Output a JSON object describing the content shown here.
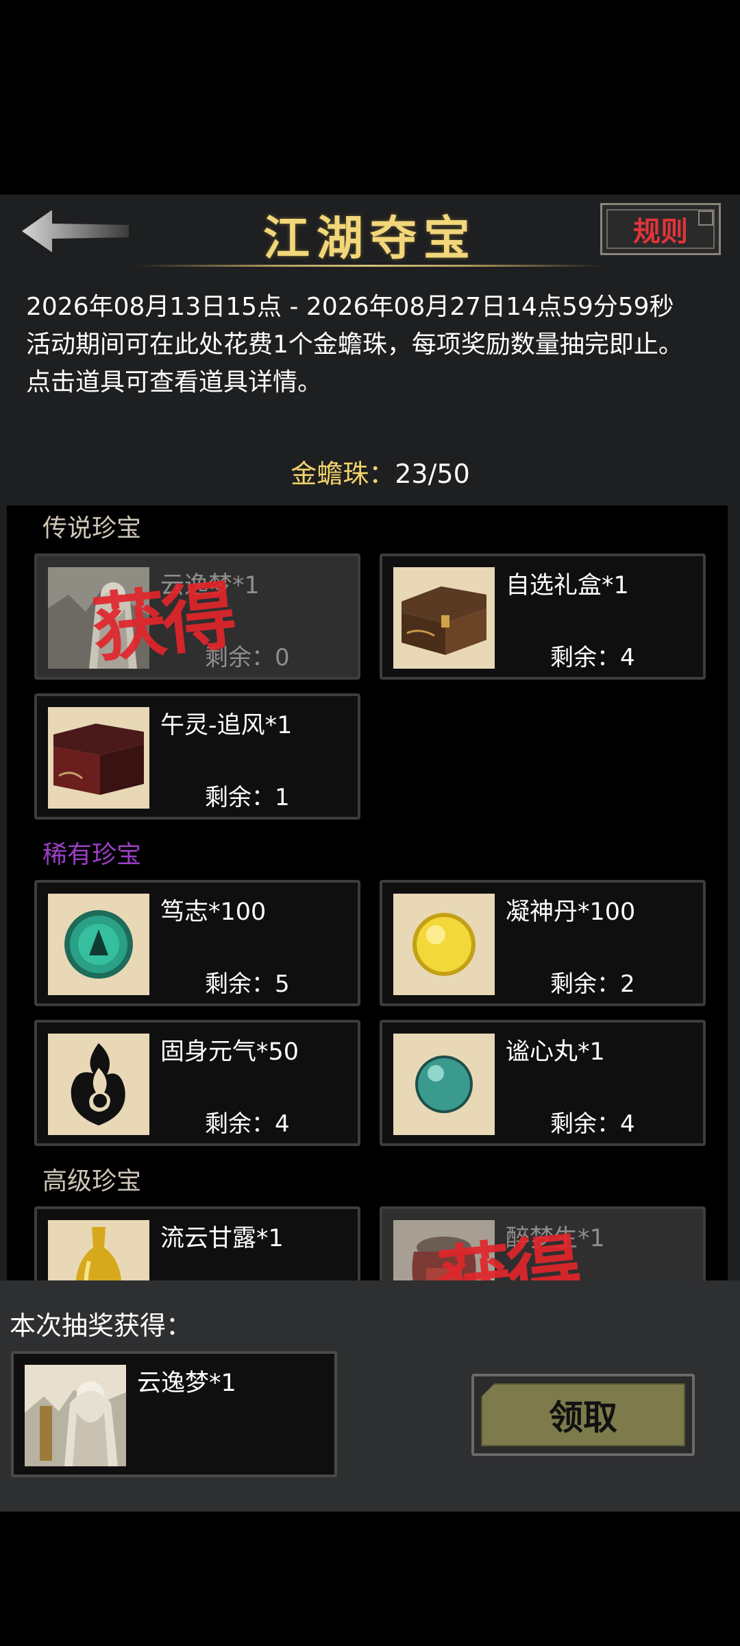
{
  "header": {
    "title": "江湖夺宝",
    "rules_label": "规则"
  },
  "description": {
    "line1": "2026年08月13日15点 - 2026年08月27日14点59分59秒",
    "line2": "活动期间可在此处花费1个金蟾珠，每项奖励数量抽完即止。",
    "line3": "点击道具可查看道具详情。"
  },
  "currency": {
    "label": "金蟾珠：",
    "value": "23/50"
  },
  "sections": [
    {
      "title": "传说珍宝",
      "items": [
        {
          "name": "云逸梦*1",
          "remain": "剩余：0",
          "obtained_stamp": "获得",
          "icon": "portrait-icon"
        },
        {
          "name": "自选礼盒*1",
          "remain": "剩余：4",
          "icon": "treasure-chest-icon"
        },
        {
          "name": "午灵-追风*1",
          "remain": "剩余：1",
          "icon": "red-chest-icon"
        }
      ]
    },
    {
      "title": "稀有珍宝",
      "items": [
        {
          "name": "笃志*100",
          "remain": "剩余：5",
          "icon": "jade-orb-icon"
        },
        {
          "name": "凝神丹*100",
          "remain": "剩余：2",
          "icon": "gold-pill-icon"
        },
        {
          "name": "固身元气*50",
          "remain": "剩余：4",
          "icon": "ink-flame-icon"
        },
        {
          "name": "谧心丸*1",
          "remain": "剩余：4",
          "icon": "teal-pill-icon"
        }
      ]
    },
    {
      "title": "高级珍宝",
      "items": [
        {
          "name": "流云甘露*1",
          "icon": "gold-bottle-icon"
        },
        {
          "name": "醉梦生*1",
          "obtained_stamp": "获得",
          "icon": "wine-jar-icon"
        }
      ]
    }
  ],
  "result": {
    "label": "本次抽奖获得：",
    "item_name": "云逸梦*1",
    "claim_label": "领取"
  },
  "colors": {
    "title_gold": "#f2d77a",
    "rare_purple": "#9c3fc6",
    "stamp_red": "#e0262b",
    "claim_olive": "#7d7a4c"
  }
}
